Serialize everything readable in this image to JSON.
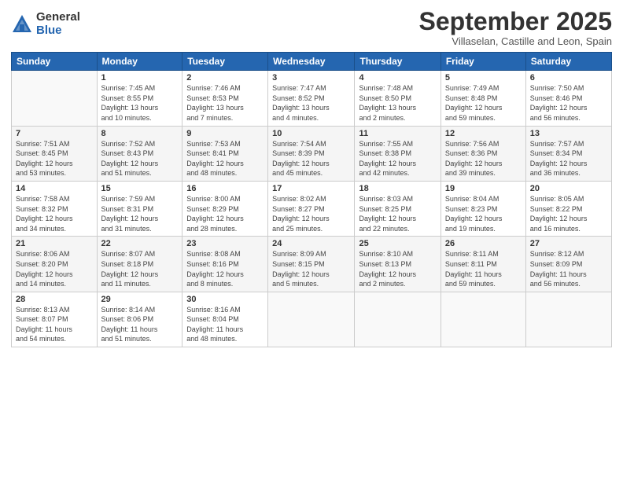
{
  "logo": {
    "general": "General",
    "blue": "Blue"
  },
  "title": "September 2025",
  "subtitle": "Villaselan, Castille and Leon, Spain",
  "days_header": [
    "Sunday",
    "Monday",
    "Tuesday",
    "Wednesday",
    "Thursday",
    "Friday",
    "Saturday"
  ],
  "weeks": [
    [
      {
        "day": "",
        "info": ""
      },
      {
        "day": "1",
        "info": "Sunrise: 7:45 AM\nSunset: 8:55 PM\nDaylight: 13 hours\nand 10 minutes."
      },
      {
        "day": "2",
        "info": "Sunrise: 7:46 AM\nSunset: 8:53 PM\nDaylight: 13 hours\nand 7 minutes."
      },
      {
        "day": "3",
        "info": "Sunrise: 7:47 AM\nSunset: 8:52 PM\nDaylight: 13 hours\nand 4 minutes."
      },
      {
        "day": "4",
        "info": "Sunrise: 7:48 AM\nSunset: 8:50 PM\nDaylight: 13 hours\nand 2 minutes."
      },
      {
        "day": "5",
        "info": "Sunrise: 7:49 AM\nSunset: 8:48 PM\nDaylight: 12 hours\nand 59 minutes."
      },
      {
        "day": "6",
        "info": "Sunrise: 7:50 AM\nSunset: 8:46 PM\nDaylight: 12 hours\nand 56 minutes."
      }
    ],
    [
      {
        "day": "7",
        "info": "Sunrise: 7:51 AM\nSunset: 8:45 PM\nDaylight: 12 hours\nand 53 minutes."
      },
      {
        "day": "8",
        "info": "Sunrise: 7:52 AM\nSunset: 8:43 PM\nDaylight: 12 hours\nand 51 minutes."
      },
      {
        "day": "9",
        "info": "Sunrise: 7:53 AM\nSunset: 8:41 PM\nDaylight: 12 hours\nand 48 minutes."
      },
      {
        "day": "10",
        "info": "Sunrise: 7:54 AM\nSunset: 8:39 PM\nDaylight: 12 hours\nand 45 minutes."
      },
      {
        "day": "11",
        "info": "Sunrise: 7:55 AM\nSunset: 8:38 PM\nDaylight: 12 hours\nand 42 minutes."
      },
      {
        "day": "12",
        "info": "Sunrise: 7:56 AM\nSunset: 8:36 PM\nDaylight: 12 hours\nand 39 minutes."
      },
      {
        "day": "13",
        "info": "Sunrise: 7:57 AM\nSunset: 8:34 PM\nDaylight: 12 hours\nand 36 minutes."
      }
    ],
    [
      {
        "day": "14",
        "info": "Sunrise: 7:58 AM\nSunset: 8:32 PM\nDaylight: 12 hours\nand 34 minutes."
      },
      {
        "day": "15",
        "info": "Sunrise: 7:59 AM\nSunset: 8:31 PM\nDaylight: 12 hours\nand 31 minutes."
      },
      {
        "day": "16",
        "info": "Sunrise: 8:00 AM\nSunset: 8:29 PM\nDaylight: 12 hours\nand 28 minutes."
      },
      {
        "day": "17",
        "info": "Sunrise: 8:02 AM\nSunset: 8:27 PM\nDaylight: 12 hours\nand 25 minutes."
      },
      {
        "day": "18",
        "info": "Sunrise: 8:03 AM\nSunset: 8:25 PM\nDaylight: 12 hours\nand 22 minutes."
      },
      {
        "day": "19",
        "info": "Sunrise: 8:04 AM\nSunset: 8:23 PM\nDaylight: 12 hours\nand 19 minutes."
      },
      {
        "day": "20",
        "info": "Sunrise: 8:05 AM\nSunset: 8:22 PM\nDaylight: 12 hours\nand 16 minutes."
      }
    ],
    [
      {
        "day": "21",
        "info": "Sunrise: 8:06 AM\nSunset: 8:20 PM\nDaylight: 12 hours\nand 14 minutes."
      },
      {
        "day": "22",
        "info": "Sunrise: 8:07 AM\nSunset: 8:18 PM\nDaylight: 12 hours\nand 11 minutes."
      },
      {
        "day": "23",
        "info": "Sunrise: 8:08 AM\nSunset: 8:16 PM\nDaylight: 12 hours\nand 8 minutes."
      },
      {
        "day": "24",
        "info": "Sunrise: 8:09 AM\nSunset: 8:15 PM\nDaylight: 12 hours\nand 5 minutes."
      },
      {
        "day": "25",
        "info": "Sunrise: 8:10 AM\nSunset: 8:13 PM\nDaylight: 12 hours\nand 2 minutes."
      },
      {
        "day": "26",
        "info": "Sunrise: 8:11 AM\nSunset: 8:11 PM\nDaylight: 11 hours\nand 59 minutes."
      },
      {
        "day": "27",
        "info": "Sunrise: 8:12 AM\nSunset: 8:09 PM\nDaylight: 11 hours\nand 56 minutes."
      }
    ],
    [
      {
        "day": "28",
        "info": "Sunrise: 8:13 AM\nSunset: 8:07 PM\nDaylight: 11 hours\nand 54 minutes."
      },
      {
        "day": "29",
        "info": "Sunrise: 8:14 AM\nSunset: 8:06 PM\nDaylight: 11 hours\nand 51 minutes."
      },
      {
        "day": "30",
        "info": "Sunrise: 8:16 AM\nSunset: 8:04 PM\nDaylight: 11 hours\nand 48 minutes."
      },
      {
        "day": "",
        "info": ""
      },
      {
        "day": "",
        "info": ""
      },
      {
        "day": "",
        "info": ""
      },
      {
        "day": "",
        "info": ""
      }
    ]
  ]
}
